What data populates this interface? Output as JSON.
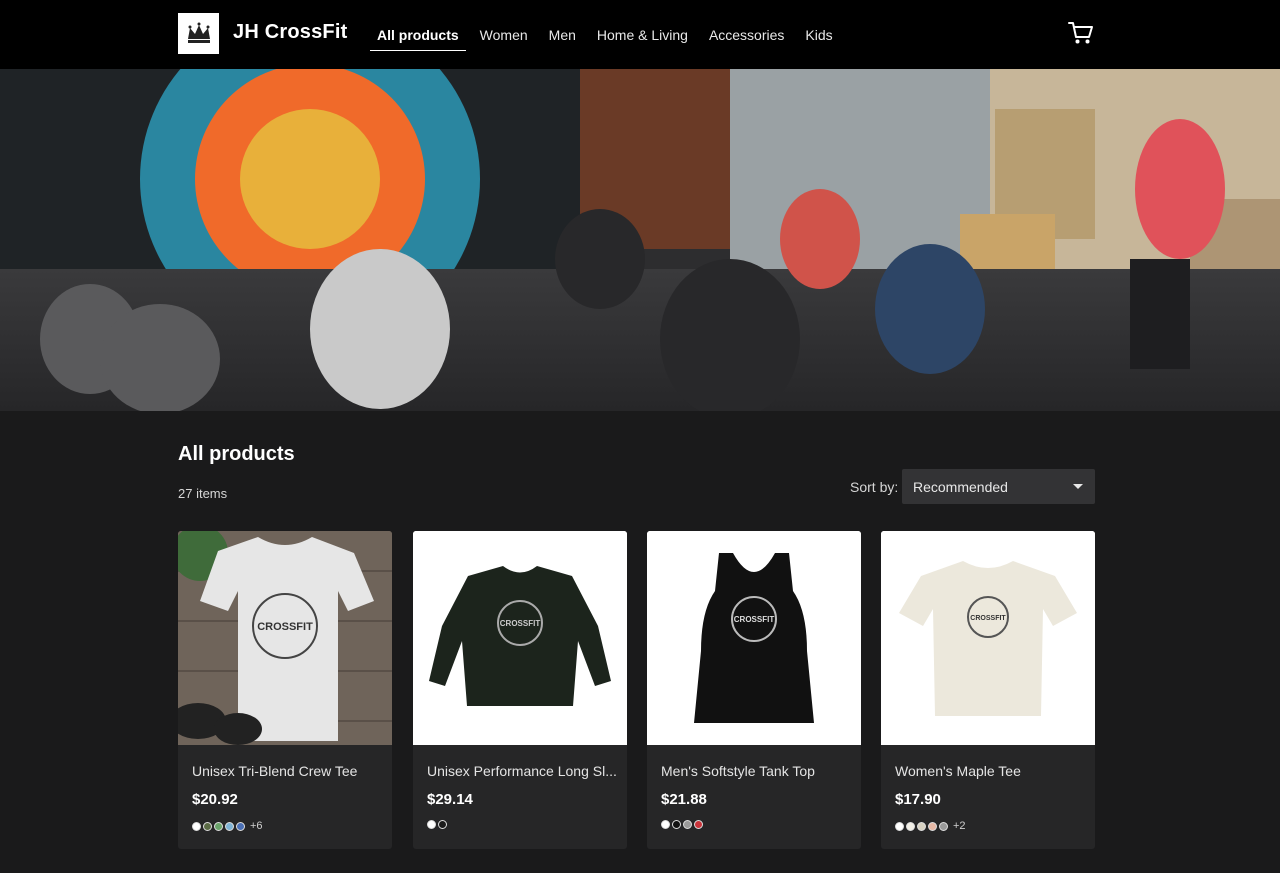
{
  "header": {
    "brand": "JH CrossFit",
    "nav": [
      "All products",
      "Women",
      "Men",
      "Home & Living",
      "Accessories",
      "Kids"
    ],
    "active_nav": "All products"
  },
  "listing": {
    "title": "All products",
    "count": "27 items",
    "sort_label": "Sort by:",
    "sort_value": "Recommended"
  },
  "products": [
    {
      "name": "Unisex Tri-Blend Crew Tee",
      "price": "$20.92",
      "swatches": [
        "#ffffff",
        "#5b6b45",
        "#6aa36a",
        "#7fb3d5",
        "#4a6fb5"
      ],
      "more": "+6"
    },
    {
      "name": "Unisex Performance Long Sl...",
      "price": "$29.14",
      "swatches": [
        "#ffffff",
        "#1b1b1b"
      ],
      "more": ""
    },
    {
      "name": "Men's Softstyle Tank Top",
      "price": "$21.88",
      "swatches": [
        "#ffffff",
        "#111111",
        "#9a9a9a",
        "#c9343b"
      ],
      "more": ""
    },
    {
      "name": "Women's Maple Tee",
      "price": "$17.90",
      "swatches": [
        "#ffffff",
        "#f2efe6",
        "#d8d2c2",
        "#e7b9a6",
        "#9a9a9a"
      ],
      "more": "+2"
    }
  ]
}
